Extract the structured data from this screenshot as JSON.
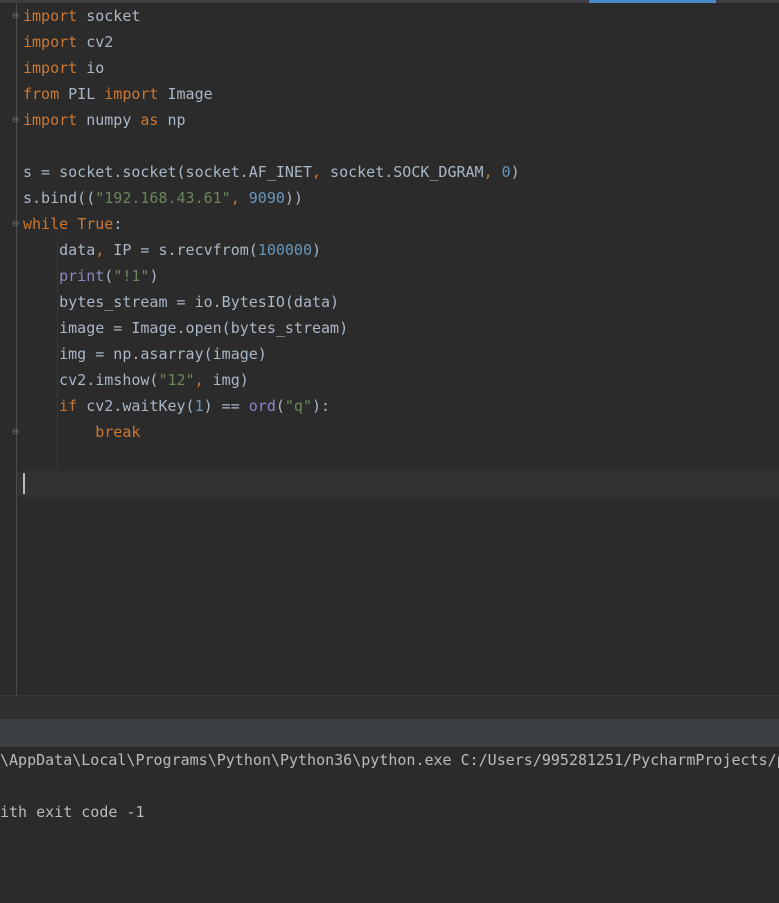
{
  "editor": {
    "lines": [
      [
        {
          "t": "import",
          "c": "kw"
        },
        {
          "t": " socket",
          "c": ""
        }
      ],
      [
        {
          "t": "import",
          "c": "kw"
        },
        {
          "t": " cv2",
          "c": ""
        }
      ],
      [
        {
          "t": "import",
          "c": "kw"
        },
        {
          "t": " io",
          "c": ""
        }
      ],
      [
        {
          "t": "from",
          "c": "kw"
        },
        {
          "t": " PIL ",
          "c": ""
        },
        {
          "t": "import",
          "c": "kw"
        },
        {
          "t": " Image",
          "c": ""
        }
      ],
      [
        {
          "t": "import",
          "c": "kw"
        },
        {
          "t": " numpy ",
          "c": ""
        },
        {
          "t": "as",
          "c": "kw"
        },
        {
          "t": " np",
          "c": ""
        }
      ],
      [],
      [
        {
          "t": "s = socket.socket(socket.AF_INET",
          "c": ""
        },
        {
          "t": ",",
          "c": "kw"
        },
        {
          "t": " socket.SOCK_DGRAM",
          "c": ""
        },
        {
          "t": ",",
          "c": "kw"
        },
        {
          "t": " ",
          "c": ""
        },
        {
          "t": "0",
          "c": "num"
        },
        {
          "t": ")",
          "c": ""
        }
      ],
      [
        {
          "t": "s.bind((",
          "c": ""
        },
        {
          "t": "\"192.168.43.61\"",
          "c": "str"
        },
        {
          "t": ",",
          "c": "kw"
        },
        {
          "t": " ",
          "c": ""
        },
        {
          "t": "9090",
          "c": "num"
        },
        {
          "t": "))",
          "c": ""
        }
      ],
      [
        {
          "t": "while",
          "c": "kw"
        },
        {
          "t": " ",
          "c": ""
        },
        {
          "t": "True",
          "c": "kw"
        },
        {
          "t": ":",
          "c": ""
        }
      ],
      [
        {
          "t": "    data",
          "c": ""
        },
        {
          "t": ",",
          "c": "kw"
        },
        {
          "t": " IP = s.recvfrom(",
          "c": ""
        },
        {
          "t": "100000",
          "c": "num"
        },
        {
          "t": ")",
          "c": ""
        }
      ],
      [
        {
          "t": "    ",
          "c": ""
        },
        {
          "t": "print",
          "c": "bi"
        },
        {
          "t": "(",
          "c": ""
        },
        {
          "t": "\"!1\"",
          "c": "str"
        },
        {
          "t": ")",
          "c": ""
        }
      ],
      [
        {
          "t": "    bytes_stream = io.BytesIO(data)",
          "c": ""
        }
      ],
      [
        {
          "t": "    image = Image.open(bytes_stream)",
          "c": ""
        }
      ],
      [
        {
          "t": "    img = np.asarray(image)",
          "c": ""
        }
      ],
      [
        {
          "t": "    cv2.imshow(",
          "c": ""
        },
        {
          "t": "\"12\"",
          "c": "str"
        },
        {
          "t": ",",
          "c": "kw"
        },
        {
          "t": " img)",
          "c": ""
        }
      ],
      [
        {
          "t": "    ",
          "c": ""
        },
        {
          "t": "if",
          "c": "kw"
        },
        {
          "t": " cv2.waitKey(",
          "c": ""
        },
        {
          "t": "1",
          "c": "num"
        },
        {
          "t": ") == ",
          "c": ""
        },
        {
          "t": "ord",
          "c": "bi"
        },
        {
          "t": "(",
          "c": ""
        },
        {
          "t": "\"q\"",
          "c": "str"
        },
        {
          "t": "):",
          "c": ""
        }
      ],
      [
        {
          "t": "        ",
          "c": ""
        },
        {
          "t": "break",
          "c": "kw"
        }
      ],
      [],
      []
    ]
  },
  "console": {
    "command_line": "\\AppData\\Local\\Programs\\Python\\Python36\\python.exe C:/Users/995281251/PycharmProjects/p",
    "exit_line": "ith exit code -1"
  },
  "colors": {
    "keyword": "#cc7832",
    "string": "#6a8759",
    "number": "#6897bb",
    "builtin": "#8888c6",
    "text": "#a9b7c6",
    "background": "#2b2b2b",
    "tab_accent": "#4a88c7"
  }
}
